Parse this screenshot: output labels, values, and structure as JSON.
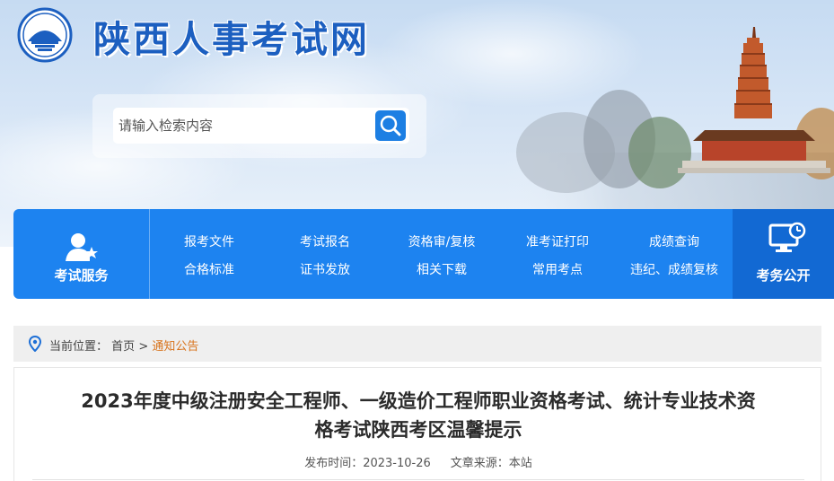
{
  "header": {
    "site_title": "陕西人事考试网",
    "logo_icon": "pagoda-emblem-icon",
    "colors": {
      "title": "#1c5fc0",
      "sky": "#c6dbf2"
    }
  },
  "search": {
    "placeholder": "请输入检索内容",
    "button_icon": "search-icon",
    "accent": "#1d7fe3"
  },
  "nav": {
    "left_label": "考试服务",
    "left_icon": "user-star-icon",
    "right_label": "考务公开",
    "right_icon": "monitor-clock-icon",
    "bg": "#1d83f0",
    "columns": [
      {
        "top": "报考文件",
        "bottom": "合格标准"
      },
      {
        "top": "考试报名",
        "bottom": "证书发放"
      },
      {
        "top": "资格审/复核",
        "bottom": "相关下载"
      },
      {
        "top": "准考证打印",
        "bottom": "常用考点"
      },
      {
        "top": "成绩查询",
        "bottom": "违纪、成绩复核"
      }
    ]
  },
  "breadcrumb": {
    "icon": "location-pin-icon",
    "prefix": "当前位置：",
    "home": "首页",
    "separator": ">",
    "current": "通知公告",
    "current_color": "#d8731c"
  },
  "article": {
    "title_line1": "2023年度中级注册安全工程师、一级造价工程师职业资格考试、统计专业技术资",
    "title_line2": "格考试陕西考区温馨提示",
    "publish_label": "发布时间：",
    "publish_date": "2023-10-26",
    "source_label": "文章来源：",
    "source": "本站"
  }
}
